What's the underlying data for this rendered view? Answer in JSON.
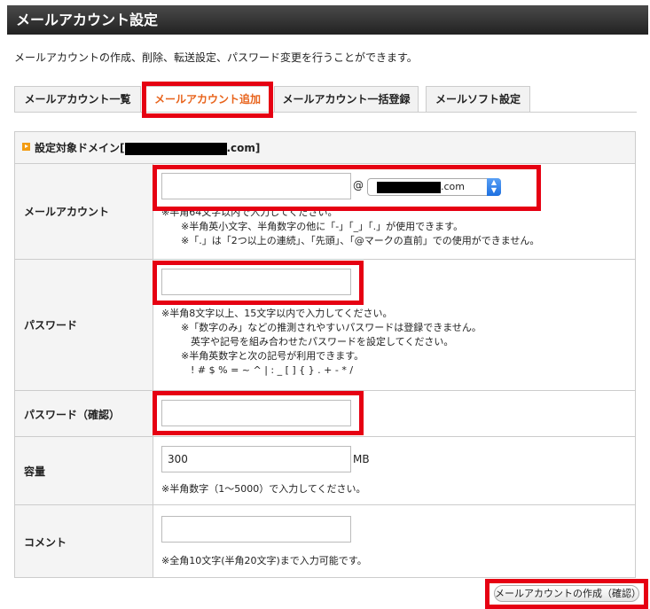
{
  "page_title": "メールアカウント設定",
  "description": "メールアカウントの作成、削除、転送設定、パスワード変更を行うことができます。",
  "tabs": [
    {
      "label": "メールアカウント一覧"
    },
    {
      "label": "メールアカウント追加"
    },
    {
      "label": "メールアカウント一括登録"
    },
    {
      "label": "メールソフト設定"
    }
  ],
  "domain": {
    "label_prefix": "設定対象ドメイン[",
    "label_suffix": ".com]"
  },
  "account": {
    "label": "メールアカウント",
    "value": "",
    "at": "@",
    "domain_select": ".com",
    "notes": "※半角64文字以内で入力してください。\n　　※半角英小文字、半角数字の他に「-」「_」「.」が使用できます。\n　　※「.」は「2つ以上の連続」、「先頭」、「@マークの直前」での使用ができません。"
  },
  "password": {
    "label": "パスワード",
    "value": "",
    "notes": "※半角8文字以上、15文字以内で入力してください。\n　　※「数字のみ」などの推測されやすいパスワードは登録できません。\n　　　英字や記号を組み合わせたパスワードを設定してください。\n　　※半角英数字と次の記号が利用できます。\n　　　! # $ % = ~ ^ | : _ [ ] { } . + - * /"
  },
  "password_confirm": {
    "label": "パスワード（確認）",
    "value": ""
  },
  "capacity": {
    "label": "容量",
    "value": "300",
    "unit": "MB",
    "notes": "※半角数字（1〜5000）で入力してください。"
  },
  "comment": {
    "label": "コメント",
    "value": "",
    "notes": "※全角10文字(半角20文字)まで入力可能です。"
  },
  "submit_label": "メールアカウントの作成（確認）",
  "colors": {
    "highlight": "#e60012",
    "active_tab": "#e8631b",
    "title_bar": "#333333"
  }
}
